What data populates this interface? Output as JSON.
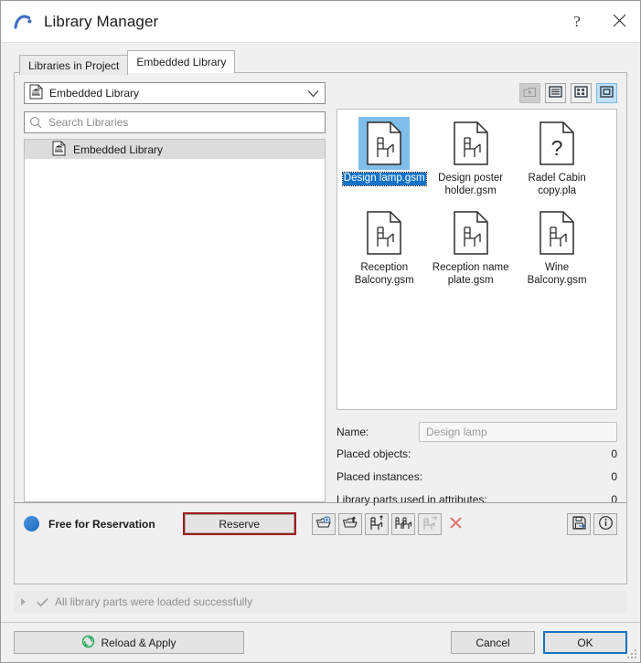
{
  "window": {
    "title": "Library Manager",
    "logo_icon": "archicad-arch-logo",
    "help_label": "?",
    "close_label": "✕"
  },
  "tabs": [
    {
      "label": "Libraries in Project",
      "active": false
    },
    {
      "label": "Embedded Library",
      "active": true
    }
  ],
  "left_panel": {
    "combo": {
      "value": "Embedded Library",
      "icon": "embedded-library-doc-icon",
      "chevron_icon": "chevron-down-icon"
    },
    "search": {
      "placeholder": "Search Libraries",
      "value": "",
      "icon": "search-icon"
    },
    "tree": {
      "items": [
        {
          "label": "Embedded Library",
          "icon": "embedded-library-doc-icon",
          "selected": true
        }
      ]
    }
  },
  "right_panel": {
    "view_buttons": [
      {
        "name": "go-up-folder-button",
        "icon": "folder-up-icon",
        "state": "disabled"
      },
      {
        "name": "list-view-button",
        "icon": "list-view-icon",
        "state": "normal"
      },
      {
        "name": "details-view-button",
        "icon": "grid-small-view-icon",
        "state": "normal"
      },
      {
        "name": "large-icons-view-button",
        "icon": "large-icon-view-icon",
        "state": "selected"
      }
    ],
    "files": [
      {
        "label": "Design lamp.gsm",
        "icon": "library-part-chair-icon",
        "selected": true
      },
      {
        "label": "Design poster holder.gsm",
        "icon": "library-part-chair-icon",
        "selected": false
      },
      {
        "label": "Radel Cabin copy.pla",
        "icon": "library-part-unknown-icon",
        "selected": false
      },
      {
        "label": "Reception Balcony.gsm",
        "icon": "library-part-chair-icon",
        "selected": false
      },
      {
        "label": "Reception name plate.gsm",
        "icon": "library-part-chair-icon",
        "selected": false
      },
      {
        "label": "Wine Balcony.gsm",
        "icon": "library-part-chair-icon",
        "selected": false
      }
    ],
    "name_field": {
      "label": "Name:",
      "value": "Design lamp"
    },
    "stats": [
      {
        "label": "Placed objects:",
        "value": "0"
      },
      {
        "label": "Placed instances:",
        "value": "0"
      },
      {
        "label": "Library parts used in attributes:",
        "value": "0"
      }
    ]
  },
  "action_bar": {
    "reservation_status": "Free for Reservation",
    "reservation_dot_color": "#2e7ad1",
    "reserve_label": "Reserve",
    "reserve_highlight_color": "#9e1b1b",
    "tool_buttons": [
      {
        "name": "add-library-part-button",
        "icon": "folder-add-icon",
        "state": "normal"
      },
      {
        "name": "export-library-part-button",
        "icon": "folder-export-icon",
        "state": "normal"
      },
      {
        "name": "upload-part-button",
        "icon": "chair-up-arrow-icon",
        "state": "normal"
      },
      {
        "name": "duplicate-part-button",
        "icon": "chairs-duplicate-icon",
        "state": "normal"
      },
      {
        "name": "move-part-button",
        "icon": "chair-right-arrow-icon",
        "state": "disabled"
      },
      {
        "name": "delete-part-button",
        "icon": "red-x-delete-icon",
        "state": "normal"
      }
    ],
    "right_buttons": [
      {
        "name": "save-as-button",
        "icon": "floppy-save-arrow-icon",
        "state": "normal"
      },
      {
        "name": "info-button",
        "icon": "info-circle-icon",
        "state": "normal"
      }
    ]
  },
  "status_strip": {
    "expander_icon": "triangle-right-icon",
    "check_icon": "check-icon",
    "message": "All library parts were loaded successfully"
  },
  "footer": {
    "reload_label": "Reload & Apply",
    "reload_icon": "green-refresh-icon",
    "cancel_label": "Cancel",
    "ok_label": "OK",
    "ok_focus_color": "#1673c4",
    "grip_icon": "resize-grip-icon"
  }
}
